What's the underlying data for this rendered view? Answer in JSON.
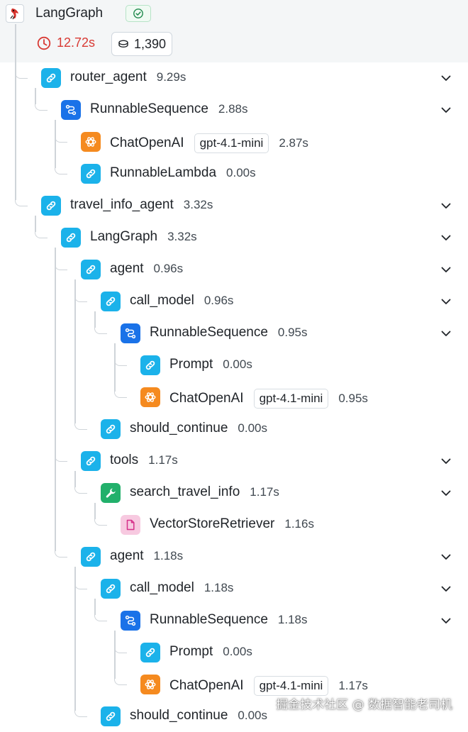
{
  "header": {
    "title": "LangGraph",
    "latency": "12.72s",
    "tokens": "1,390",
    "status_icon": "check-circle-icon",
    "latency_icon": "clock-icon",
    "token_icon": "coins-icon"
  },
  "runs": [
    {
      "name": "router_agent",
      "time": "9.29s",
      "type": "chain",
      "depth": 1,
      "expandable": true
    },
    {
      "name": "RunnableSequence",
      "time": "2.88s",
      "type": "sequence",
      "depth": 2,
      "expandable": true
    },
    {
      "name": "ChatOpenAI",
      "time": "2.87s",
      "type": "llm",
      "model": "gpt-4.1-mini",
      "depth": 3,
      "expandable": false
    },
    {
      "name": "RunnableLambda",
      "time": "0.00s",
      "type": "chain",
      "depth": 3,
      "expandable": false
    },
    {
      "name": "travel_info_agent",
      "time": "3.32s",
      "type": "chain",
      "depth": 1,
      "expandable": true
    },
    {
      "name": "LangGraph",
      "time": "3.32s",
      "type": "chain",
      "depth": 2,
      "expandable": true
    },
    {
      "name": "agent",
      "time": "0.96s",
      "type": "chain",
      "depth": 3,
      "expandable": true
    },
    {
      "name": "call_model",
      "time": "0.96s",
      "type": "chain",
      "depth": 4,
      "expandable": true
    },
    {
      "name": "RunnableSequence",
      "time": "0.95s",
      "type": "sequence",
      "depth": 5,
      "expandable": true
    },
    {
      "name": "Prompt",
      "time": "0.00s",
      "type": "chain",
      "depth": 6,
      "expandable": false
    },
    {
      "name": "ChatOpenAI",
      "time": "0.95s",
      "type": "llm",
      "model": "gpt-4.1-mini",
      "depth": 6,
      "expandable": false
    },
    {
      "name": "should_continue",
      "time": "0.00s",
      "type": "chain",
      "depth": 4,
      "expandable": false
    },
    {
      "name": "tools",
      "time": "1.17s",
      "type": "chain",
      "depth": 3,
      "expandable": true
    },
    {
      "name": "search_travel_info",
      "time": "1.17s",
      "type": "tool",
      "depth": 4,
      "expandable": true
    },
    {
      "name": "VectorStoreRetriever",
      "time": "1.16s",
      "type": "retriever",
      "depth": 5,
      "expandable": false
    },
    {
      "name": "agent",
      "time": "1.18s",
      "type": "chain",
      "depth": 3,
      "expandable": true
    },
    {
      "name": "call_model",
      "time": "1.18s",
      "type": "chain",
      "depth": 4,
      "expandable": true
    },
    {
      "name": "RunnableSequence",
      "time": "1.18s",
      "type": "sequence",
      "depth": 5,
      "expandable": true
    },
    {
      "name": "Prompt",
      "time": "0.00s",
      "type": "chain",
      "depth": 6,
      "expandable": false
    },
    {
      "name": "ChatOpenAI",
      "time": "1.17s",
      "type": "llm",
      "model": "gpt-4.1-mini",
      "depth": 6,
      "expandable": false
    },
    {
      "name": "should_continue",
      "time": "0.00s",
      "type": "chain",
      "depth": 4,
      "expandable": false
    }
  ],
  "watermark": "掘金技术社区 @ 数据智能老司机",
  "colors": {
    "chain": "#1bb2ea",
    "sequence": "#1a72e8",
    "llm": "#f58a1f",
    "tool": "#22b06b",
    "retriever": "#f7c9e0",
    "latency": "#d83a34",
    "connector": "#cfd4d9",
    "header_bg": "#f4f6f7"
  }
}
